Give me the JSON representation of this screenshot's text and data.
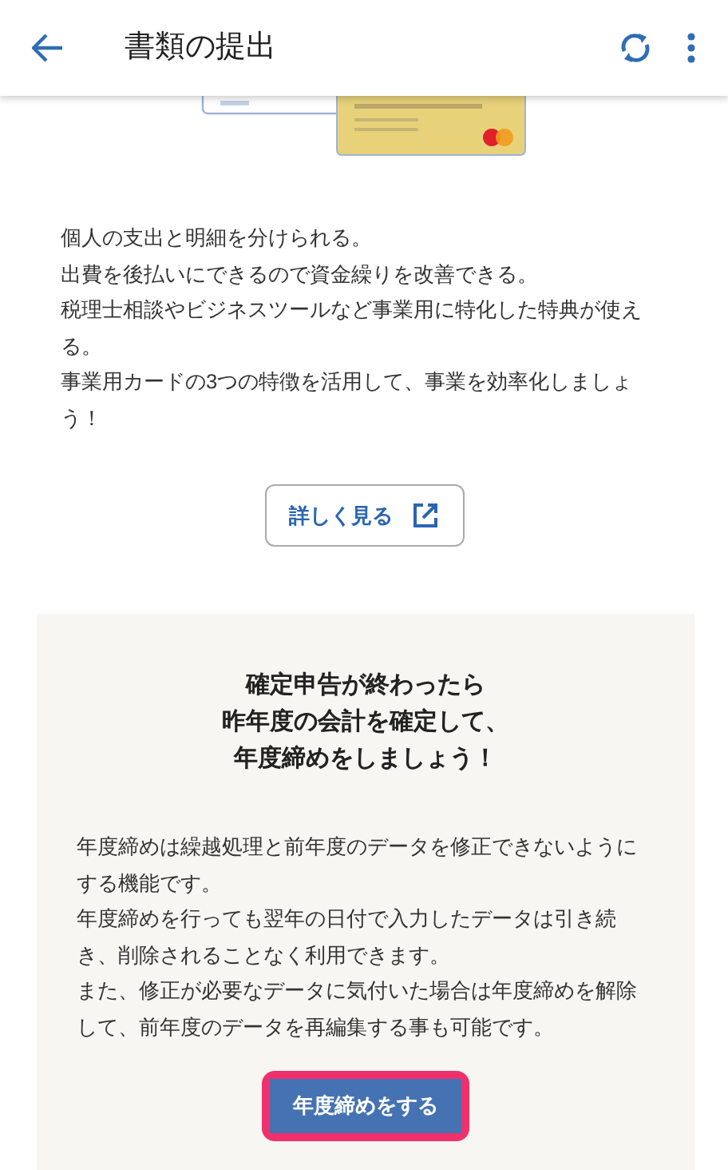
{
  "header": {
    "title": "書類の提出"
  },
  "card_promo": {
    "lines": [
      "個人の支出と明細を分けられる。",
      "出費を後払いにできるので資金繰りを改善できる。",
      "税理士相談やビジネスツールなど事業用に特化した特典が使える。",
      "事業用カードの3つの特徴を活用して、事業を効率化しましょう！"
    ],
    "link_button": {
      "label": "詳しく見る"
    }
  },
  "year_end": {
    "heading_lines": [
      "確定申告が終わったら",
      "昨年度の会計を確定して、",
      "年度締めをしましょう！"
    ],
    "paragraphs": [
      "年度締めは繰越処理と前年度のデータを修正できないようにする機能です。",
      "年度締めを行っても翌年の日付で入力したデータは引き続き、削除されることなく利用できます。",
      "また、修正が必要なデータに気付いた場合は年度締めを解除して、前年度のデータを再編集する事も可能です。"
    ],
    "button": {
      "label": "年度締めをする",
      "highlighted": true
    }
  }
}
